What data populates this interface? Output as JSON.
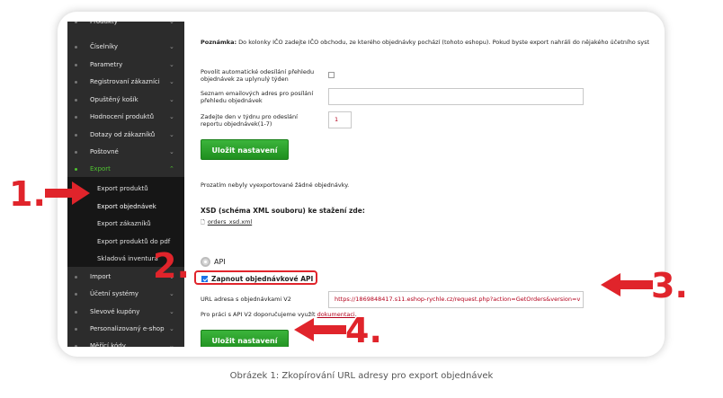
{
  "sidebar": {
    "top_partial": "Produkty",
    "items_before": [
      {
        "label": "Číselníky",
        "chev": "⌄"
      },
      {
        "label": "Parametry",
        "chev": "⌄"
      },
      {
        "label": "Registrovaní zákazníci",
        "chev": "⌄"
      },
      {
        "label": "Opuštěný košík",
        "chev": "⌄"
      },
      {
        "label": "Hodnocení produktů",
        "chev": "⌄"
      },
      {
        "label": "Dotazy od zákazníků",
        "chev": "⌄"
      },
      {
        "label": "Poštovné",
        "chev": "⌄"
      }
    ],
    "active_item": {
      "label": "Export",
      "chev": "⌃"
    },
    "submenu": [
      "Export produktů",
      "Export objednávek",
      "Export zákazníků",
      "Export produktů do pdf",
      "Skladová inventura"
    ],
    "items_after": [
      {
        "label": "Import",
        "chev": "⌄"
      },
      {
        "label": "Účetní systémy",
        "chev": "⌄"
      },
      {
        "label": "Slevové kupóny",
        "chev": "⌄"
      },
      {
        "label": "Personalizovaný e-shop",
        "chev": "⌄"
      },
      {
        "label": "Měřící kódy",
        "chev": "⌄"
      }
    ]
  },
  "content": {
    "note_bold": "Poznámka:",
    "note_text": " Do kolonky IČO zadejte IČO obchodu, ze kterého objednávky pochází (tohoto eshopu). Pokud byste export nahráli do nějakého účetního syst",
    "auto_send_label": "Povolit automatické odesílání přehledu objednávek za uplynulý týden",
    "emails_label": "Seznam emailových adres pro posílání přehledu objednávek",
    "emails_value": "",
    "day_label": "Zadejte den v týdnu pro odeslání reportu objednávek(1-7)",
    "day_value": "1",
    "save_button": "Uložit nastavení",
    "no_exports": "Prozatím nebyly vyexportované žádné objednávky.",
    "xsd_title": "XSD (schéma XML souboru) ke stažení zde:",
    "xsd_file": "orders_xsd.xml",
    "api_label": "API",
    "enable_api_label": "Zapnout objednávkové API",
    "url_label": "URL adresa s objednávkami V2",
    "url_value": "https://1869848417.s11.eshop-rychle.cz/request.php?action=GetOrders&version=v",
    "doc_text": "Pro práci s API V2 doporučujeme využít ",
    "doc_link": "dokumentaci",
    "doc_end": ".",
    "save_button_2": "Uložit nastavení"
  },
  "annotations": {
    "step1": "1.",
    "step2": "2.",
    "step3": "3.",
    "step4": "4.",
    "color": "#e0242b"
  },
  "caption": "Obrázek 1: Zkopírování URL adresy pro export objednávek"
}
